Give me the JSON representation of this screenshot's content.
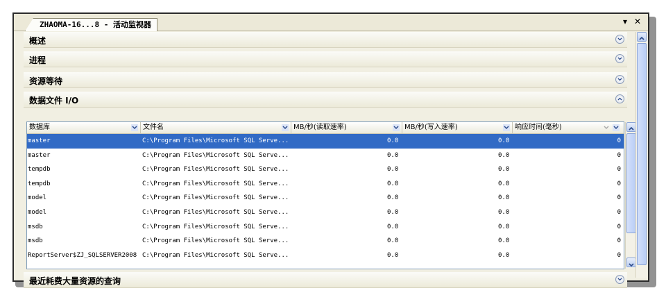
{
  "window": {
    "tab_title": "ZHAOMA-16...8 - 活动监视器",
    "dropdown_glyph": "▾",
    "close_glyph": "✕"
  },
  "sections": [
    {
      "title": "概述"
    },
    {
      "title": "进程"
    },
    {
      "title": "资源等待"
    },
    {
      "title": "数据文件 I/O"
    },
    {
      "title": "最近耗费大量资源的查询"
    }
  ],
  "grid": {
    "columns": [
      "数据库",
      "文件名",
      "MB/秒(读取速率)",
      "MB/秒(写入速率)",
      "响应时间(毫秒)"
    ],
    "rows": [
      [
        "master",
        "C:\\Program Files\\Microsoft SQL Serve...",
        "0.0",
        "0.0",
        "0"
      ],
      [
        "master",
        "C:\\Program Files\\Microsoft SQL Serve...",
        "0.0",
        "0.0",
        "0"
      ],
      [
        "tempdb",
        "C:\\Program Files\\Microsoft SQL Serve...",
        "0.0",
        "0.0",
        "0"
      ],
      [
        "tempdb",
        "C:\\Program Files\\Microsoft SQL Serve...",
        "0.0",
        "0.0",
        "0"
      ],
      [
        "model",
        "C:\\Program Files\\Microsoft SQL Serve...",
        "0.0",
        "0.0",
        "0"
      ],
      [
        "model",
        "C:\\Program Files\\Microsoft SQL Serve...",
        "0.0",
        "0.0",
        "0"
      ],
      [
        "msdb",
        "C:\\Program Files\\Microsoft SQL Serve...",
        "0.0",
        "0.0",
        "0"
      ],
      [
        "msdb",
        "C:\\Program Files\\Microsoft SQL Serve...",
        "0.0",
        "0.0",
        "0"
      ],
      [
        "ReportServer$ZJ_SQLSERVER2008",
        "C:\\Program Files\\Microsoft SQL Serve...",
        "0.0",
        "0.0",
        "0"
      ]
    ],
    "selected_row": 0
  },
  "colors": {
    "selection": "#316ac5",
    "panel": "#f1efe2",
    "border": "#7f9db9"
  },
  "icons": {
    "section_toggle": "chevron-circle-icon",
    "column_filter": "dropdown-arrow-icon"
  }
}
